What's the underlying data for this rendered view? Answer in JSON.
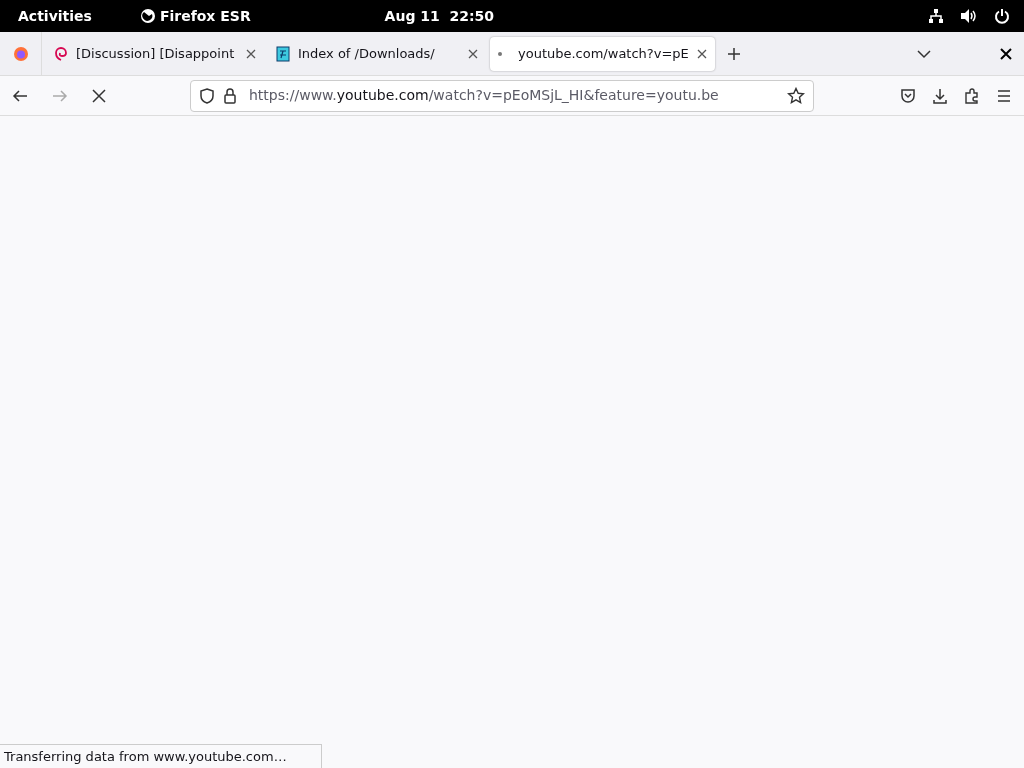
{
  "top_bar": {
    "activities": "Activities",
    "app_name": "Firefox ESR",
    "clock": "Aug 11  22:50"
  },
  "tabs": [
    {
      "title": "[Discussion] [Disappoint",
      "kind": "swirl",
      "selected": false
    },
    {
      "title": "Index of /Downloads/",
      "kind": "file",
      "selected": false
    },
    {
      "title": "youtube.com/watch?v=pE",
      "kind": "dot",
      "selected": true
    }
  ],
  "address_bar": {
    "scheme": "https://www.",
    "host": "youtube.com",
    "path": "/watch?v=pEoMSjL_HI&feature=youtu.be"
  },
  "status_bar": "Transferring data from www.youtube.com…"
}
